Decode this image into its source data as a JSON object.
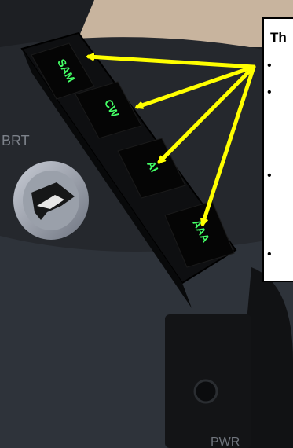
{
  "callout": {
    "title_visible": "Th",
    "bullet": "•"
  },
  "buttons": [
    {
      "label": "SAM"
    },
    {
      "label": "CW"
    },
    {
      "label": "AI"
    },
    {
      "label": "AAA"
    }
  ],
  "panel_labels": {
    "brightness": "BRT",
    "power": "PWR"
  },
  "colors": {
    "arrow": "#ffff00",
    "button_text": "#44ff66",
    "panel": "#141517"
  }
}
